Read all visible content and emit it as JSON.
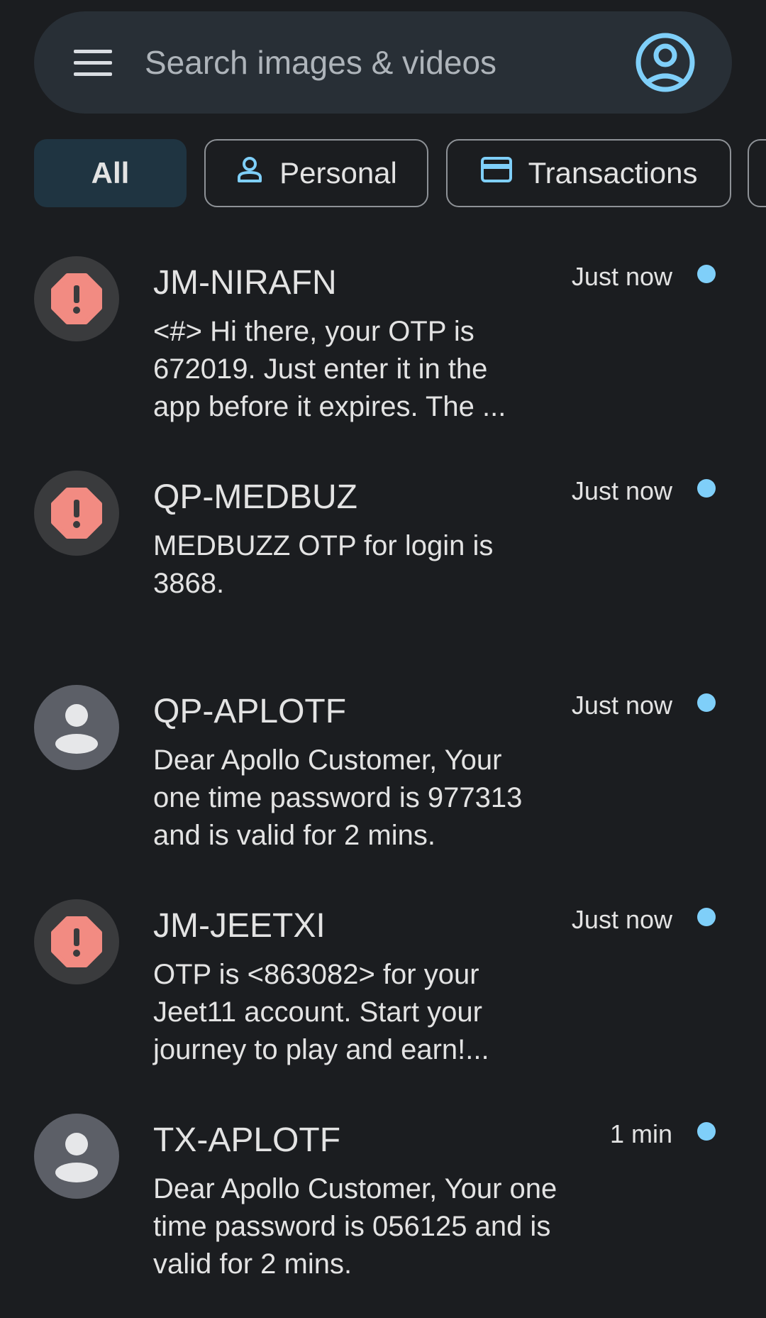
{
  "search": {
    "placeholder": "Search images & videos"
  },
  "chips": [
    {
      "label": "All",
      "selected": true
    },
    {
      "label": "Personal",
      "icon": "person-outline-icon"
    },
    {
      "label": "Transactions",
      "icon": "credit-card-icon"
    }
  ],
  "colors": {
    "background": "#1b1d20",
    "searchbar": "#282f36",
    "chip_selected": "#1f3441",
    "accent": "#7fcff9",
    "alert_red": "#f28b82",
    "person_avatar": "#5c5f67"
  },
  "conversations": [
    {
      "sender": "JM-NIRAFN",
      "avatar": "alert",
      "time": "Just now",
      "unread": true,
      "snippet": [
        "<#> Hi there, your OTP is",
        "672019. Just enter it in the",
        "app before it expires. The ..."
      ]
    },
    {
      "sender": "QP-MEDBUZ",
      "avatar": "alert",
      "time": "Just now",
      "unread": true,
      "snippet": [
        "MEDBUZZ OTP for login is",
        "3868."
      ]
    },
    {
      "sender": "QP-APLOTF",
      "avatar": "person",
      "time": "Just now",
      "unread": true,
      "snippet": [
        "Dear Apollo Customer, Your",
        "one time password is 977313",
        "and is valid for 2 mins."
      ]
    },
    {
      "sender": "JM-JEETXI",
      "avatar": "alert",
      "time": "Just now",
      "unread": true,
      "snippet": [
        "OTP is <863082> for your",
        "Jeet11 account. Start your",
        "journey to play and earn!..."
      ]
    },
    {
      "sender": "TX-APLOTF",
      "avatar": "person",
      "time": "1 min",
      "unread": true,
      "snippet": [
        "Dear Apollo Customer, Your one",
        "time password is 056125 and is",
        "valid for 2 mins."
      ]
    }
  ]
}
